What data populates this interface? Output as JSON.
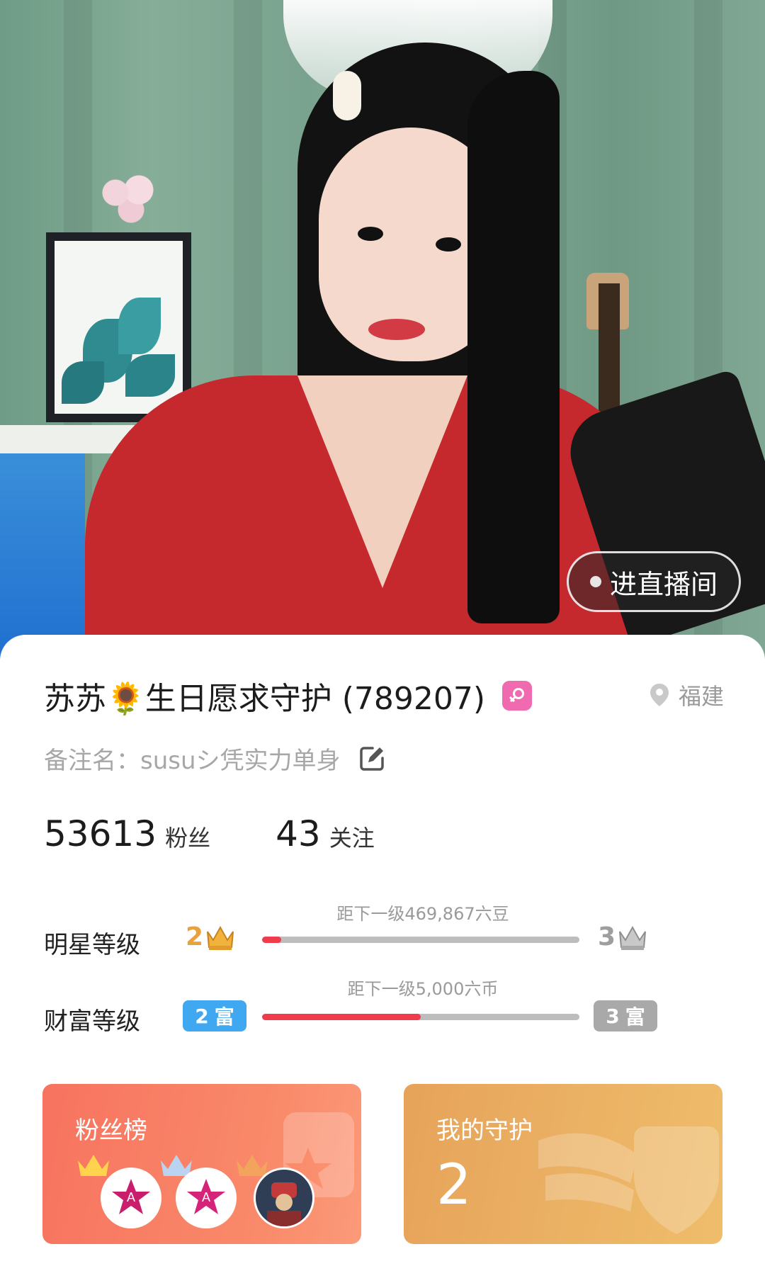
{
  "hero": {
    "live_button_label": "进直播间"
  },
  "profile": {
    "name": "苏苏🌻生日愿求守护 (789207)",
    "gender": "female",
    "location": "福建",
    "remark": "备注名：susuシ凭实力单身",
    "fans_count": "53613",
    "fans_label": "粉丝",
    "following_count": "43",
    "following_label": "关注"
  },
  "star_level": {
    "title": "明星等级",
    "current": "2",
    "next": "3",
    "hint": "距下一级469,867六豆",
    "progress": 0.06
  },
  "wealth_level": {
    "title": "财富等级",
    "current": "2",
    "next": "3",
    "badge_char": "富",
    "hint": "距下一级5,000六币",
    "progress": 0.5,
    "current_color": "#3fa8f0",
    "next_color": "#a9a9a9"
  },
  "cards": {
    "fans_rank_title": "粉丝榜",
    "guard_title": "我的守护",
    "guard_count": "2"
  },
  "colors": {
    "accent_red": "#ef3b4c",
    "fans_card": "#f7735f",
    "guard_card": "#e6a35a",
    "gender_pink": "#f06ab0"
  }
}
